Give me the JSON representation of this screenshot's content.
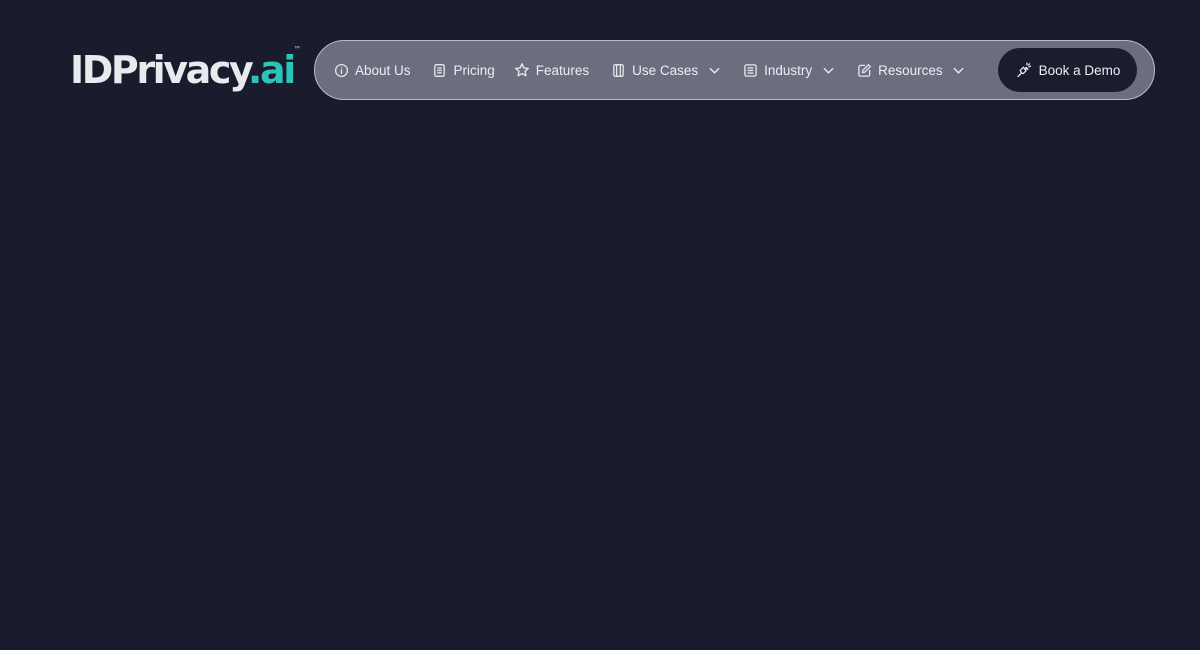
{
  "brand": {
    "logo_main": "IDPrivacy",
    "logo_accent": ".ai",
    "logo_tm": "™",
    "accent_color": "#2fc3b7"
  },
  "nav": {
    "items": [
      {
        "label": "About Us",
        "icon": "info-circle-icon",
        "has_dropdown": false
      },
      {
        "label": "Pricing",
        "icon": "document-icon",
        "has_dropdown": false
      },
      {
        "label": "Features",
        "icon": "star-icon",
        "has_dropdown": false
      },
      {
        "label": "Use Cases",
        "icon": "notebook-icon",
        "has_dropdown": true
      },
      {
        "label": "Industry",
        "icon": "list-icon",
        "has_dropdown": true
      },
      {
        "label": "Resources",
        "icon": "edit-icon",
        "has_dropdown": true
      }
    ],
    "cta": {
      "label": "Book a Demo",
      "icon": "sparkle-hand-icon"
    }
  },
  "colors": {
    "background": "#1a1c2e",
    "nav_pill": "#6c6d7e",
    "cta_bg": "#1b1d2e"
  }
}
